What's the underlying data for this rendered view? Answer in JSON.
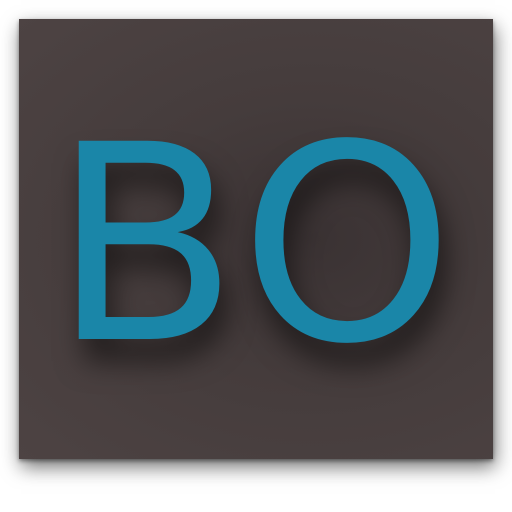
{
  "logo": {
    "text": "BO",
    "text_color": "#1a86a8",
    "background_color": "#453c3c"
  }
}
